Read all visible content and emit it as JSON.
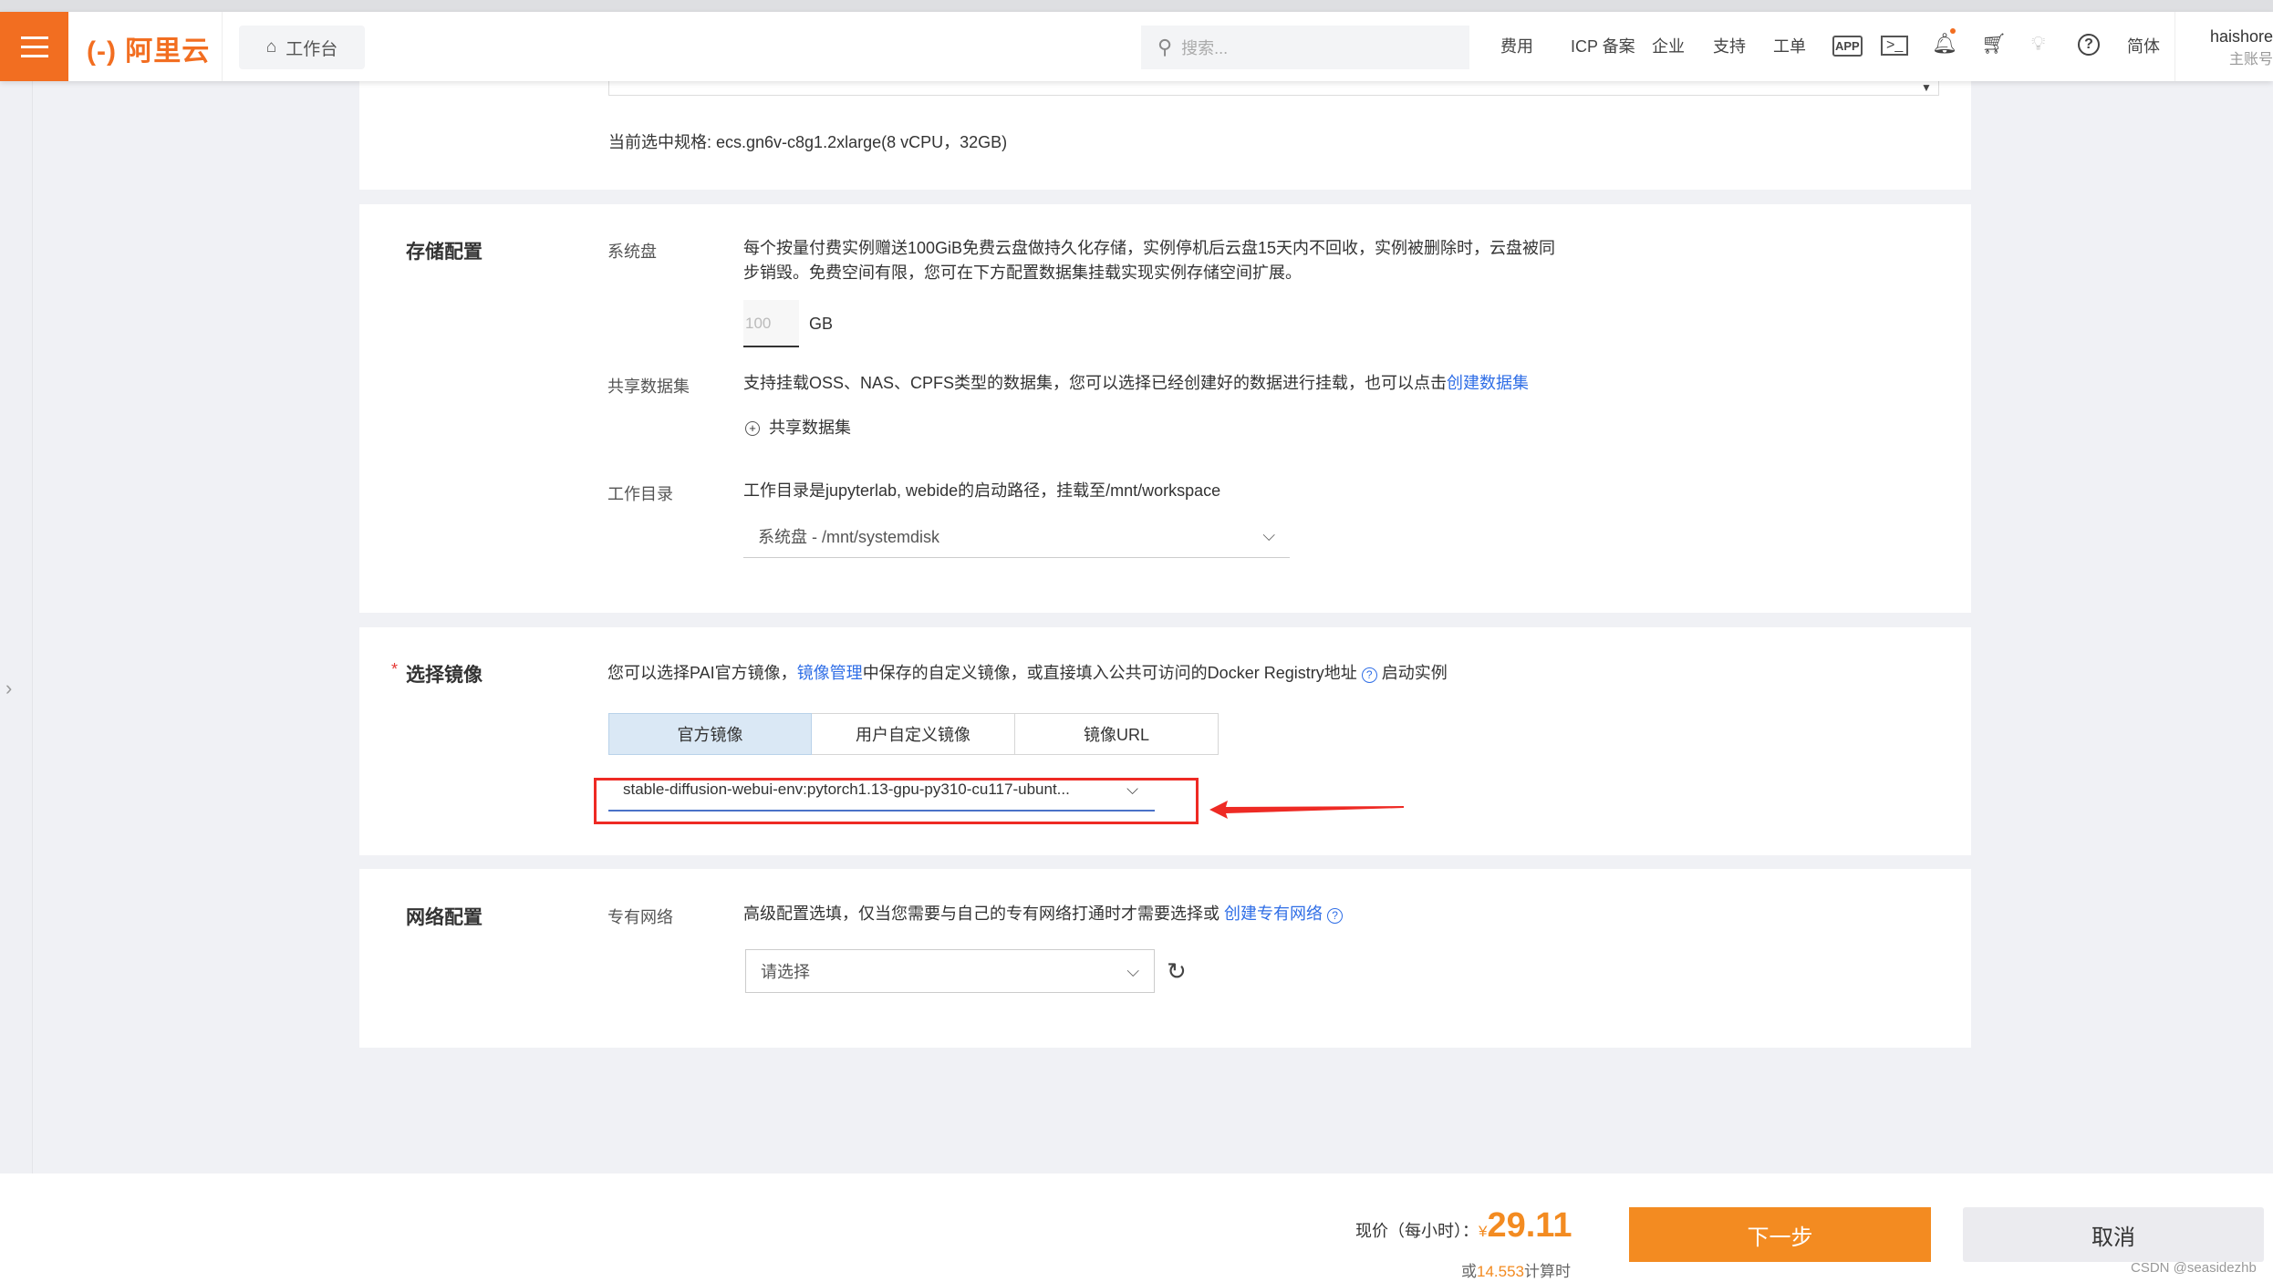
{
  "header": {
    "logo": "(-) 阿里云",
    "workbench": "工作台",
    "search_placeholder": "搜索...",
    "nav": [
      "费用",
      "ICP 备案",
      "企业",
      "支持",
      "工单"
    ],
    "lang": "简体",
    "user": "haishore",
    "account_type": "主账号",
    "accent": "#f26e21"
  },
  "spec": {
    "current": "当前选中规格: ecs.gn6v-c8g1.2xlarge(8 vCPU，32GB)"
  },
  "storage": {
    "title": "存储配置",
    "system_disk_label": "系统盘",
    "system_disk_desc_1": "每个按量付费实例赠送100GiB免费云盘做持久化存储，实例停机后云盘15天内不回收，实例被删除时，云盘被同",
    "system_disk_desc_2": "步销毁。免费空间有限，您可在下方配置数据集挂载实现实例存储空间扩展。",
    "disk_size": "100",
    "disk_unit": "GB",
    "dataset_label": "共享数据集",
    "dataset_desc": "支持挂载OSS、NAS、CPFS类型的数据集，您可以选择已经创建好的数据进行挂载，也可以点击",
    "dataset_link": "创建数据集",
    "add_dataset": "共享数据集",
    "workdir_label": "工作目录",
    "workdir_desc": "工作目录是jupyterlab, webide的启动路径，挂载至/mnt/workspace",
    "workdir_value": "系统盘 - /mnt/systemdisk"
  },
  "image": {
    "title": "选择镜像",
    "required": "*",
    "desc_1": "您可以选择PAI官方镜像，",
    "desc_link": "镜像管理",
    "desc_2": "中保存的自定义镜像，或直接填入公共可访问的Docker Registry地址",
    "desc_3": "启动实例",
    "tabs": [
      "官方镜像",
      "用户自定义镜像",
      "镜像URL"
    ],
    "active_tab": 0,
    "selected": "stable-diffusion-webui-env:pytorch1.13-gpu-py310-cu117-ubunt..."
  },
  "network": {
    "title": "网络配置",
    "vpc_label": "专有网络",
    "vpc_desc": "高级配置选填，仅当您需要与自己的专有网络打通时才需要选择或",
    "vpc_link": "创建专有网络",
    "vpc_placeholder": "请选择"
  },
  "footer": {
    "price_label": "现价（每小时）：",
    "currency": "¥",
    "price": "29.11",
    "alt_prefix": "或",
    "alt_value": "14.553",
    "alt_suffix": "计算时",
    "next": "下一步",
    "cancel": "取消",
    "watermark": "CSDN @seasidezhb"
  }
}
